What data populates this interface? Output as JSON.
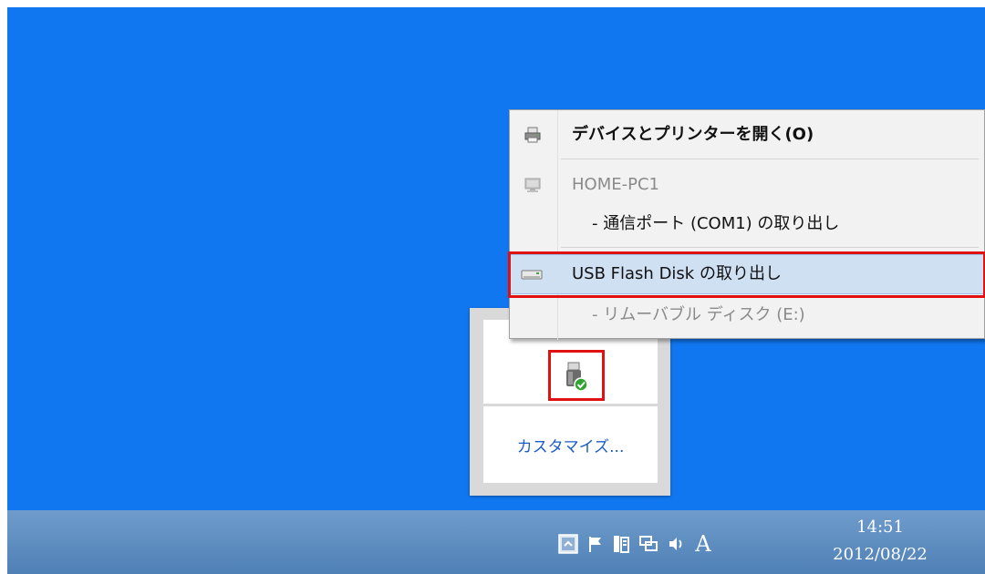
{
  "context_menu": {
    "open_devices_label": "デバイスとプリンターを開く(O)",
    "computer_name": "HOME-PC1",
    "com_port_label": "-  通信ポート (COM1) の取り出し",
    "usb_label": "USB Flash Disk の取り出し",
    "removable_disk_label": "-  リムーバブル ディスク (E:)"
  },
  "tray_overflow": {
    "customize_label": "カスタマイズ..."
  },
  "taskbar": {
    "time": "14:51",
    "date": "2012/08/22",
    "ime_label": "A"
  },
  "icons": {
    "printer": "printer-icon",
    "computer": "computer-icon",
    "usb_drive": "usb-drive-icon",
    "safely_remove": "safely-remove-hardware-icon",
    "show_desktop": "show-desktop-icon",
    "flag": "action-center-flag-icon",
    "network": "network-icon",
    "volume": "volume-icon"
  },
  "colors": {
    "desktop": "#1077f0",
    "highlight_outline": "#e01111",
    "menu_highlight": "#cfe0f3"
  }
}
